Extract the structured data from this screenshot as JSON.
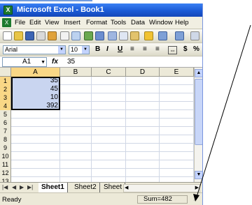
{
  "window": {
    "title": "Microsoft Excel - Book1"
  },
  "menu": {
    "items": [
      "File",
      "Edit",
      "View",
      "Insert",
      "Format",
      "Tools",
      "Data",
      "Window",
      "Help"
    ]
  },
  "toolbar": {
    "font_name": "Arial",
    "font_size": "10",
    "bold_label": "B",
    "italic_label": "I",
    "underline_label": "U",
    "currency_label": "$",
    "percent_label": "%"
  },
  "formula_bar": {
    "name_box": "A1",
    "fx_label": "fx",
    "value": "35"
  },
  "grid": {
    "columns": [
      "A",
      "B",
      "C",
      "D",
      "E"
    ],
    "rows": [
      "1",
      "2",
      "3",
      "4",
      "5",
      "6",
      "7",
      "8",
      "9",
      "10",
      "11",
      "12",
      "13"
    ],
    "cells": {
      "A1": "35",
      "A2": "45",
      "A3": "10",
      "A4": "392"
    }
  },
  "sheets": {
    "tabs": [
      "Sheet1",
      "Sheet2",
      "Sheet"
    ],
    "active": "Sheet1"
  },
  "status": {
    "ready": "Ready",
    "sum": "Sum=482"
  },
  "colors": {
    "title_bar": "#1b5bd6",
    "selection_fill": "#c9d5f0",
    "header_highlight": "#f9d786"
  }
}
